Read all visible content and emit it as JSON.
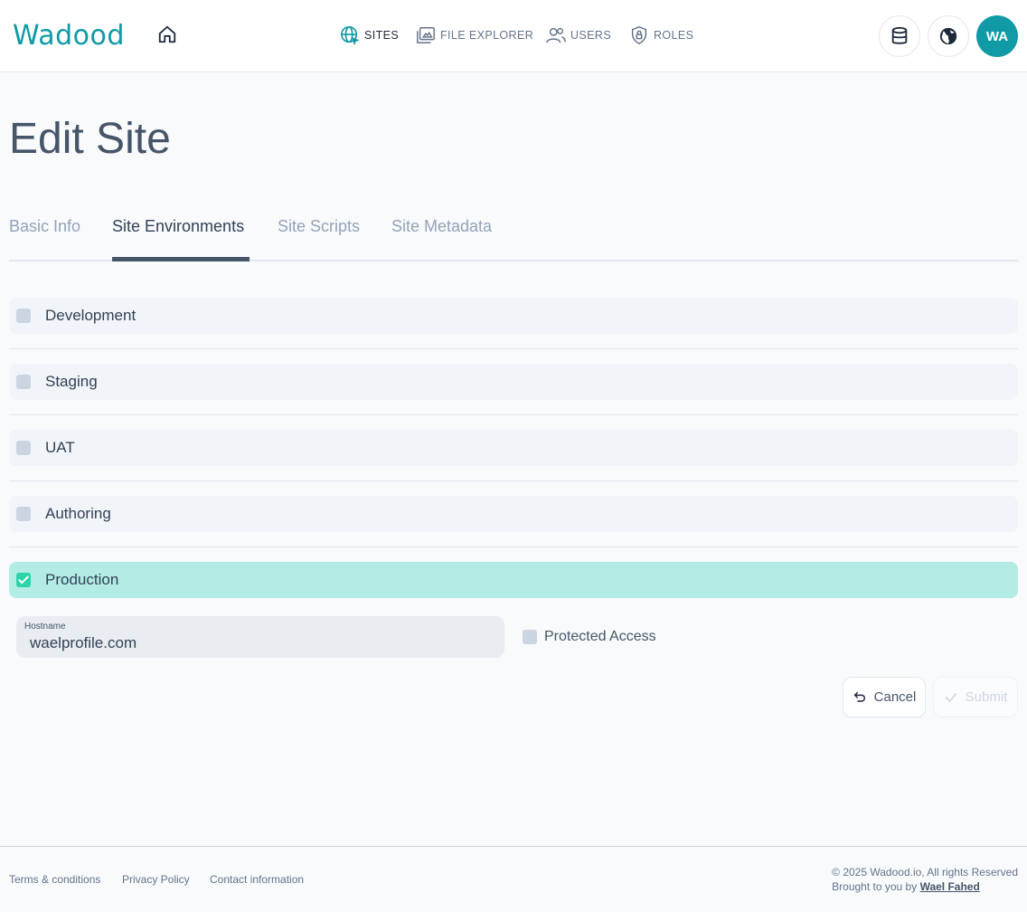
{
  "header": {
    "logo": "Wadood",
    "nav": [
      {
        "label": "SITES",
        "icon": "globe-icon",
        "active": true
      },
      {
        "label": "FILE EXPLORER",
        "icon": "folder-icon",
        "active": false
      },
      {
        "label": "USERS",
        "icon": "users-icon",
        "active": false
      },
      {
        "label": "ROLES",
        "icon": "shield-lock-icon",
        "active": false
      }
    ],
    "avatar_initials": "WA"
  },
  "page": {
    "title": "Edit Site",
    "tabs": [
      "Basic Info",
      "Site Environments",
      "Site Scripts",
      "Site Metadata"
    ],
    "active_tab": "Site Environments"
  },
  "environments": [
    {
      "label": "Development",
      "checked": false
    },
    {
      "label": "Staging",
      "checked": false
    },
    {
      "label": "UAT",
      "checked": false
    },
    {
      "label": "Authoring",
      "checked": false
    },
    {
      "label": "Production",
      "checked": true
    }
  ],
  "production_settings": {
    "hostname_label": "Hostname",
    "hostname_value": "waelprofile.com",
    "protected_access_label": "Protected Access",
    "protected_access_checked": false
  },
  "actions": {
    "cancel_label": "Cancel",
    "submit_label": "Submit"
  },
  "footer": {
    "links": [
      "Terms & conditions",
      "Privacy Policy",
      "Contact information"
    ],
    "copyright": "© 2025 Wadood.io, All rights Reserved",
    "brought_by": "Brought to you by",
    "author": "Wael Fahed"
  },
  "colors": {
    "brand": "#0f9aa6",
    "checked_row": "#b2ece4",
    "checkbox_on": "#2dd4a7"
  }
}
